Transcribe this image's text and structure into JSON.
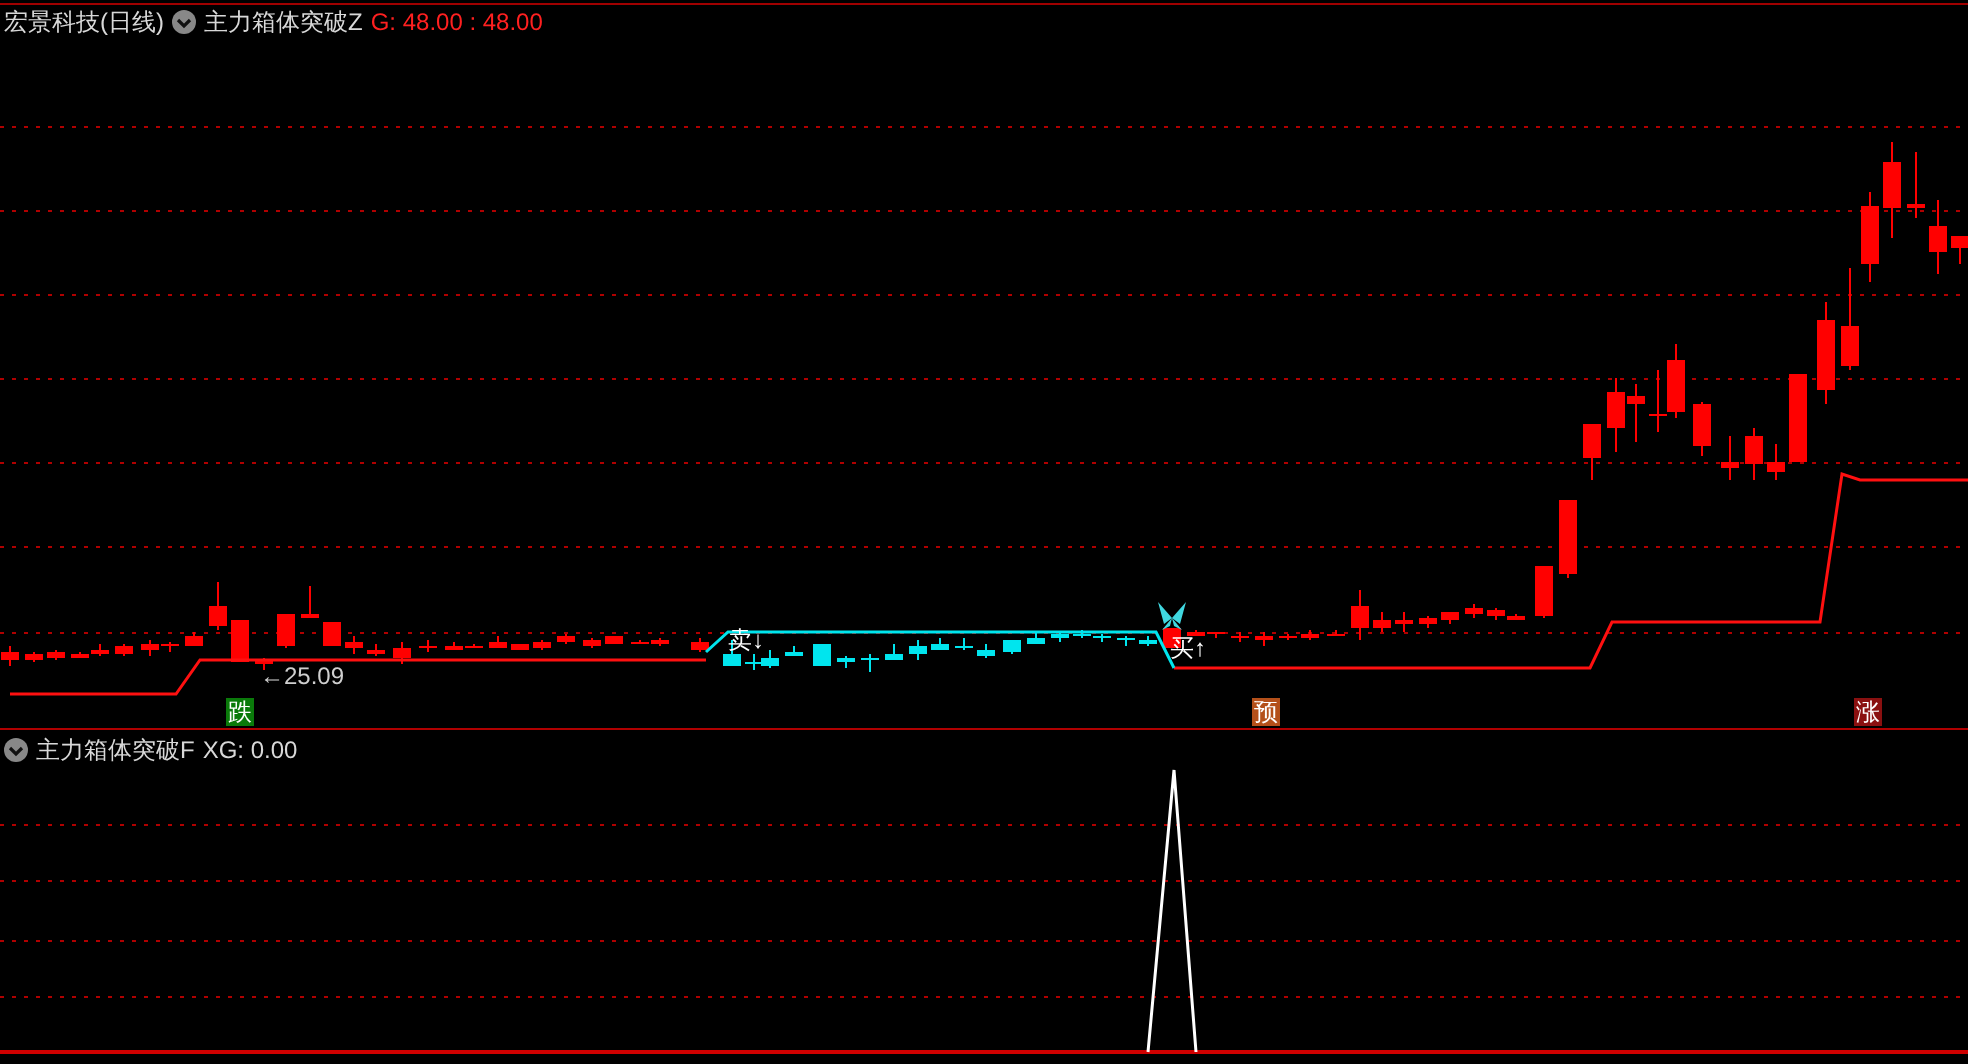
{
  "main_panel": {
    "stock_title": "宏景科技(日线)",
    "indicator_name": "主力箱体突破Z",
    "indicator_values": "G: 48.00 : 48.00",
    "price_note": "←25.09",
    "trade_marks": [
      {
        "kind": "sell",
        "label": "卖↓"
      },
      {
        "kind": "buy",
        "label": "买↑"
      }
    ],
    "signal_tags": [
      {
        "label": "跌",
        "color": "#0a7a0a"
      },
      {
        "label": "预",
        "color": "#b4501a"
      },
      {
        "label": "涨",
        "color": "#8a1010"
      }
    ]
  },
  "sub_panel": {
    "indicator_name": "主力箱体突破F",
    "indicator_values": "XG: 0.00"
  }
}
